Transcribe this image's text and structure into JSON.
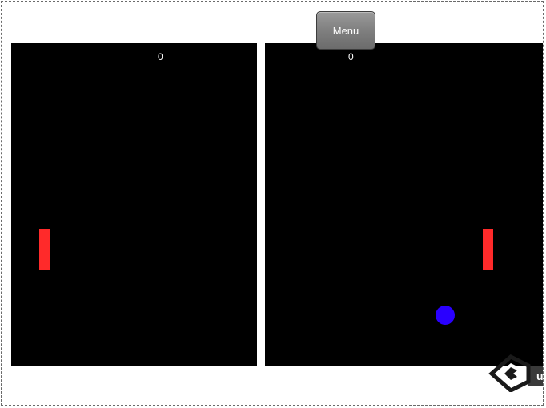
{
  "menu": {
    "label": "Menu"
  },
  "scores": {
    "left": "0",
    "right": "0"
  },
  "colors": {
    "court": "#000000",
    "paddle": "#ff2a2a",
    "ball": "#2a00ff",
    "background": "#ffffff"
  },
  "icons": {
    "engine_logo": "unity-logo-icon"
  }
}
